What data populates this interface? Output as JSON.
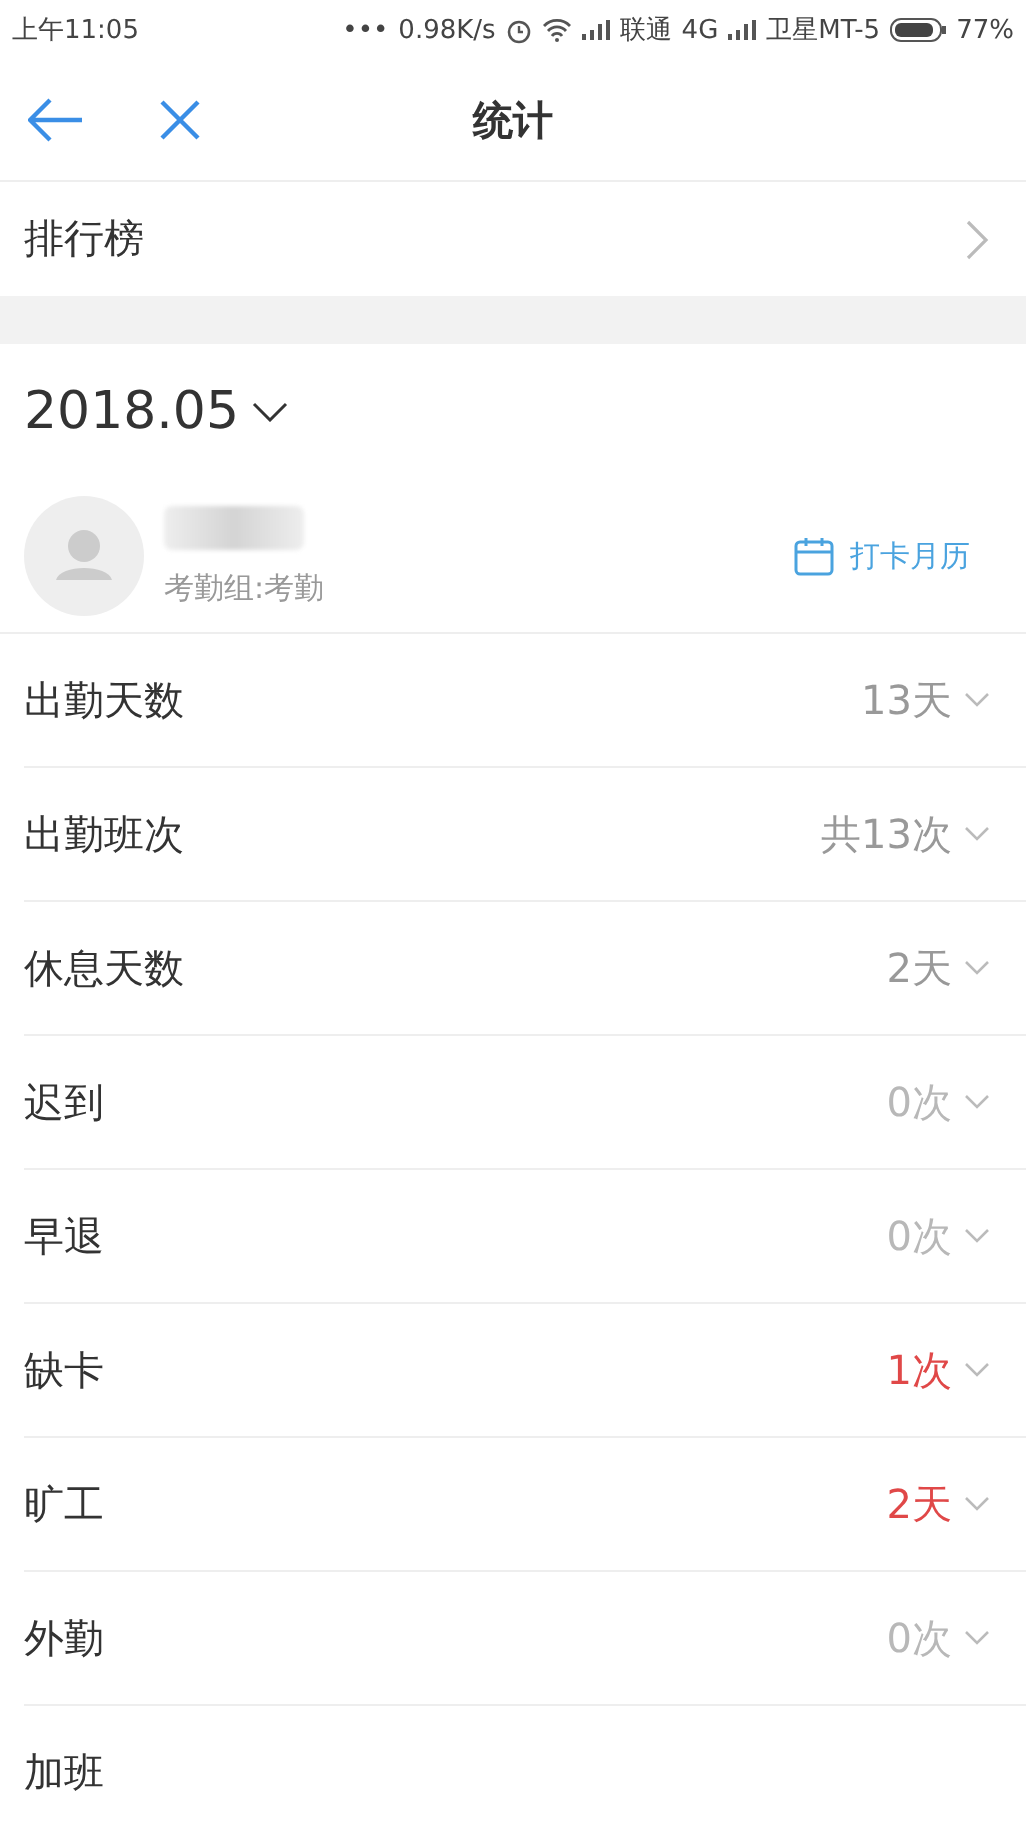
{
  "status_bar": {
    "time": "上午11:05",
    "dots": "•••",
    "speed": "0.98K/s",
    "carrier_1": "联通",
    "network": "4G",
    "carrier_2": "卫星MT-5",
    "battery": "77%"
  },
  "nav": {
    "title": "统计"
  },
  "ranking": {
    "label": "排行榜"
  },
  "month": {
    "label": "2018.05"
  },
  "profile": {
    "group": "考勤组:考勤",
    "calendar_link": "打卡月历"
  },
  "stats": [
    {
      "label": "出勤天数",
      "value": "13天",
      "kind": "normal"
    },
    {
      "label": "出勤班次",
      "value": "共13次",
      "kind": "normal"
    },
    {
      "label": "休息天数",
      "value": "2天",
      "kind": "normal"
    },
    {
      "label": "迟到",
      "value": "0次",
      "kind": "zero"
    },
    {
      "label": "早退",
      "value": "0次",
      "kind": "zero"
    },
    {
      "label": "缺卡",
      "value": "1次",
      "kind": "alert"
    },
    {
      "label": "旷工",
      "value": "2天",
      "kind": "alert"
    },
    {
      "label": "外勤",
      "value": "0次",
      "kind": "zero"
    },
    {
      "label": "加班"
    }
  ]
}
